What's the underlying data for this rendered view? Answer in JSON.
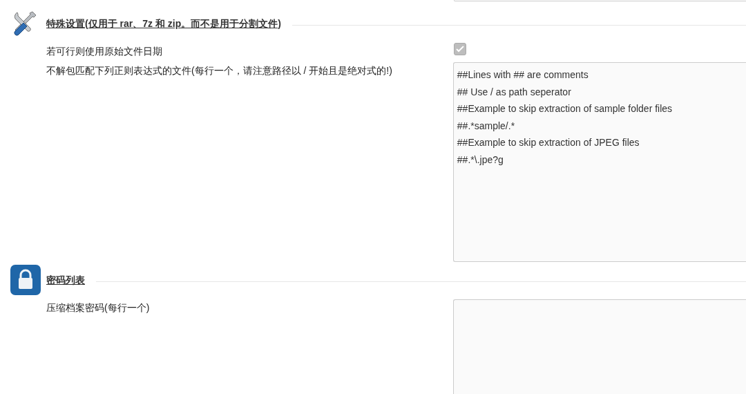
{
  "sections": [
    {
      "kind": "tools",
      "title": "特殊设置(仅用于 rar、7z 和 zip。而不是用于分割文件)",
      "rows": [
        {
          "kind": "checkbox",
          "label": "若可行则使用原始文件日期",
          "checked": true
        },
        {
          "kind": "textarea",
          "label": "不解包匹配下列正则表达式的文件(每行一个，请注意路径以 / 开始且是绝对式的!)",
          "value": "##Lines with ## are comments\n## Use / as path seperator\n##Example to skip extraction of sample folder files\n##.*sample/.*\n##Example to skip extraction of JPEG files\n##.*\\.jpe?g"
        }
      ]
    },
    {
      "kind": "lock",
      "title": "密码列表",
      "rows": [
        {
          "kind": "textarea",
          "label": "压缩档案密码(每行一个)",
          "value": ""
        }
      ]
    }
  ]
}
